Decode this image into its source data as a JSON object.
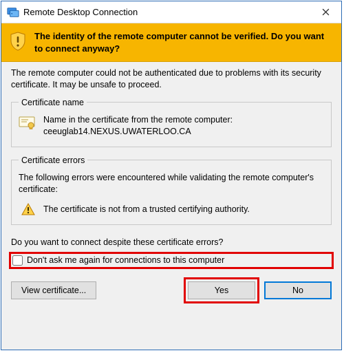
{
  "window": {
    "title": "Remote Desktop Connection"
  },
  "banner": {
    "text": "The identity of the remote computer cannot be verified. Do you want to connect anyway?"
  },
  "explanation": "The remote computer could not be authenticated due to problems with its security certificate. It may be unsafe to proceed.",
  "cert_name": {
    "legend": "Certificate name",
    "label": "Name in the certificate from the remote computer:",
    "value": "ceeuglab14.NEXUS.UWATERLOO.CA"
  },
  "cert_errors": {
    "legend": "Certificate errors",
    "intro": "The following errors were encountered while validating the remote computer's certificate:",
    "items": [
      "The certificate is not from a trusted certifying authority."
    ]
  },
  "prompt": "Do you want to connect despite these certificate errors?",
  "checkbox": {
    "label": "Don't ask me again for connections to this computer"
  },
  "buttons": {
    "view_cert": "View certificate...",
    "yes": "Yes",
    "no": "No"
  }
}
